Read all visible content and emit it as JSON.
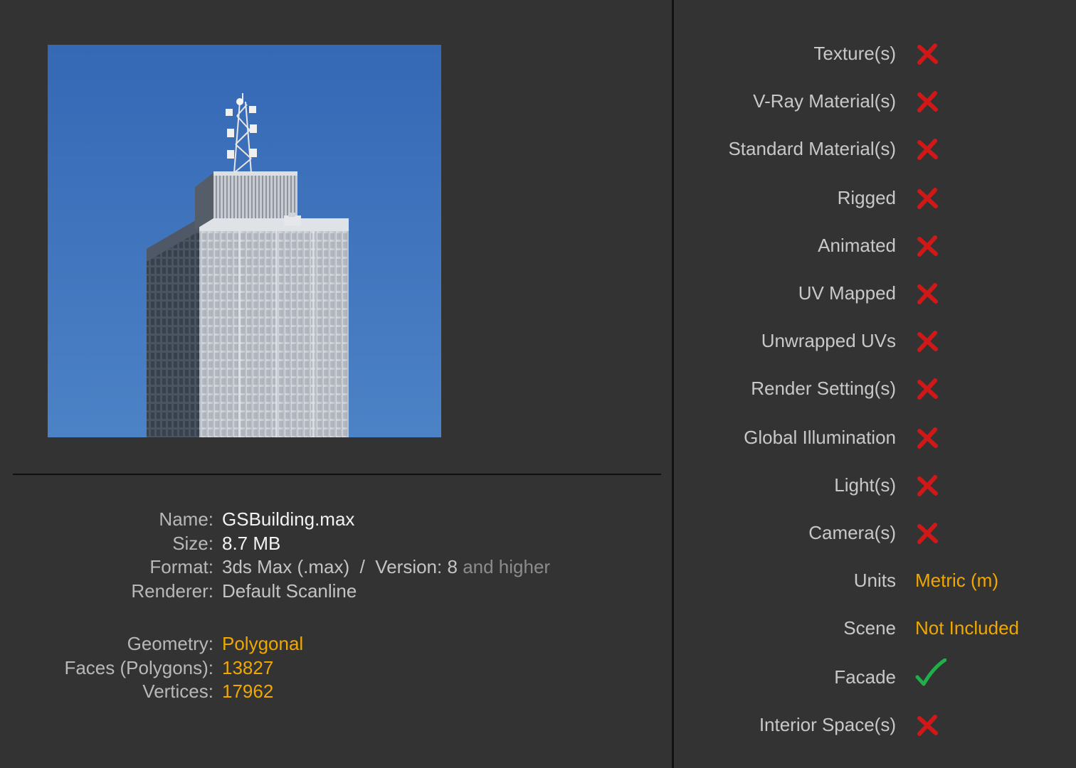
{
  "preview": {
    "icon": "building-preview-image",
    "sky_color": "#3e74bd"
  },
  "info": {
    "name_label": "Name:",
    "name_value": "GSBuilding.max",
    "size_label": "Size:",
    "size_value": "8.7 MB",
    "format_label": "Format:",
    "format_value": "3ds Max (.max)",
    "format_separator": "/",
    "version_label": "Version:",
    "version_value": "8",
    "version_suffix": "and higher",
    "renderer_label": "Renderer:",
    "renderer_value": "Default Scanline",
    "geometry_label": "Geometry:",
    "geometry_value": "Polygonal",
    "faces_label": "Faces (Polygons):",
    "faces_value": "13827",
    "vertices_label": "Vertices:",
    "vertices_value": "17962"
  },
  "features": [
    {
      "label": "Texture(s)",
      "status": "no"
    },
    {
      "label": "V-Ray Material(s)",
      "status": "no"
    },
    {
      "label": "Standard Material(s)",
      "status": "no"
    },
    {
      "label": "Rigged",
      "status": "no"
    },
    {
      "label": "Animated",
      "status": "no"
    },
    {
      "label": "UV Mapped",
      "status": "no"
    },
    {
      "label": "Unwrapped UVs",
      "status": "no"
    },
    {
      "label": "Render Setting(s)",
      "status": "no"
    },
    {
      "label": "Global Illumination",
      "status": "no"
    },
    {
      "label": "Light(s)",
      "status": "no"
    },
    {
      "label": "Camera(s)",
      "status": "no"
    },
    {
      "label": "Units",
      "status": "text",
      "value": "Metric (m)"
    },
    {
      "label": "Scene",
      "status": "text",
      "value": "Not Included"
    },
    {
      "label": "Facade",
      "status": "yes"
    },
    {
      "label": "Interior Space(s)",
      "status": "no"
    }
  ],
  "colors": {
    "background": "#333333",
    "accent_orange": "#f0a800",
    "cross_red": "#d01818",
    "check_green": "#1fb04a"
  },
  "icons": {
    "no": "red-cross-icon",
    "yes": "green-check-icon"
  }
}
